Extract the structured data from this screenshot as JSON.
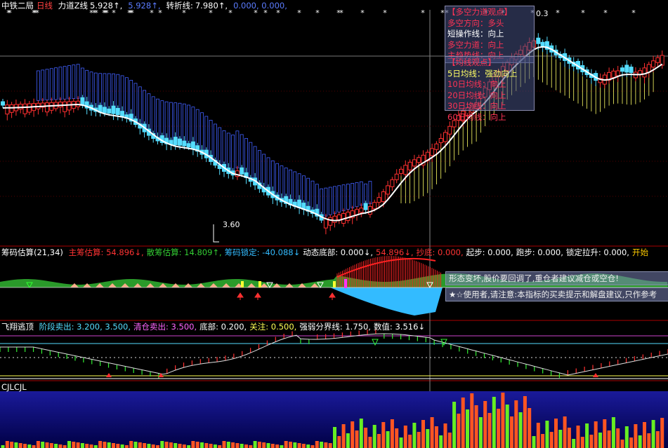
{
  "main_panel": {
    "stock_name": "中铁二局",
    "period": "日线",
    "items": [
      {
        "label": "力道Z线",
        "value": "5.928↑,",
        "color": "#ffffff"
      },
      {
        "label": "",
        "value": "5.928↑,",
        "color": "#5b7cff"
      },
      {
        "label": "转折线:",
        "value": "7.980↑,",
        "color": "#ffffff"
      },
      {
        "label": "",
        "value": "0.000, 0.000,",
        "color": "#5b7cff"
      }
    ],
    "low_price_label": "3.60",
    "high_price_label": "0.3"
  },
  "tooltip_a": {
    "title": "【多空力道观点】",
    "lines": [
      {
        "text": "多空方向：多头",
        "color": "#ff3355"
      },
      {
        "text": "短操作线：向上",
        "color": "#ffffff"
      },
      {
        "text": "多空力道：向上",
        "color": "#ff3355"
      },
      {
        "text": "主趋势线：向上",
        "color": "#ff3355"
      }
    ]
  },
  "tooltip_b": {
    "title": "【均线观点】",
    "lines": [
      {
        "text": "5日均线：强劲向上",
        "color": "#ffff66"
      },
      {
        "text": "10日均线：向上",
        "color": "#ff3355"
      },
      {
        "text": "20日均线：向上",
        "color": "#ff3355"
      },
      {
        "text": "30日均线：向上",
        "color": "#ff3355"
      },
      {
        "text": "60日均线：向上",
        "color": "#ff3355"
      }
    ]
  },
  "chip_panel": {
    "title": "筹码估算",
    "params": "(21,34)",
    "items": [
      {
        "text": "主筹估算: 54.896↓,",
        "color": "#ff3333"
      },
      {
        "text": "散筹估算: 14.809↑,",
        "color": "#33cc33"
      },
      {
        "text": "筹码锁定: -40.088↓",
        "color": "#33bbff"
      },
      {
        "text": "动态底部: 0.000↓,",
        "color": "#ffffff"
      },
      {
        "text": "54.896↓,",
        "color": "#ff3333"
      },
      {
        "text": "抄底: 0.000,",
        "color": "#ff3333"
      },
      {
        "text": "起步: 0.000,",
        "color": "#ffffff"
      },
      {
        "text": "跑步: 0.000,",
        "color": "#ffffff"
      },
      {
        "text": "锁定拉升: 0.000,",
        "color": "#ffffff"
      },
      {
        "text": "开始",
        "color": "#ffcc00"
      }
    ],
    "banner1": "形态变坏,股价要回调了,重仓者建议减仓或空仓!",
    "banner2": "★☆使用者,请注意:本指标的买卖提示和解盘建议,只作参考"
  },
  "escape_panel": {
    "title": "飞翔逃顶",
    "items": [
      {
        "text": "阶段卖出: 3.200, 3.500,",
        "color": "#55ddff"
      },
      {
        "text": "清仓卖出: 3.500,",
        "color": "#ff66ff"
      },
      {
        "text": "底部: 0.200,",
        "color": "#ffffff"
      },
      {
        "text": "关注: 0.500,",
        "color": "#ffff55"
      },
      {
        "text": "强弱分界线: 1.750,",
        "color": "#ffffff"
      },
      {
        "text": "数值: 3.516↓",
        "color": "#ffffff"
      }
    ]
  },
  "volume_panel": {
    "title": "CJLCJL"
  },
  "colors": {
    "up": "#ff3030",
    "down": "#55ddff",
    "ma": "#ffffff",
    "channel_blue": "#4060ff",
    "channel_yellow": "#ffff66",
    "panel_border": "#aa0000"
  }
}
